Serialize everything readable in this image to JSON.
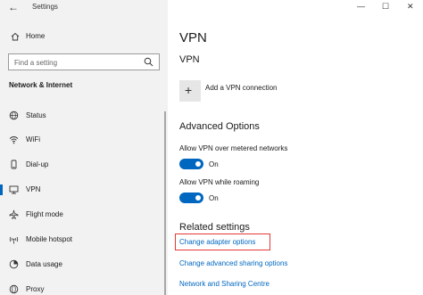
{
  "window": {
    "title": "Settings",
    "back_icon": "back-arrow-icon",
    "controls": {
      "minimize": "—",
      "maximize": "☐",
      "close": "✕"
    }
  },
  "sidebar": {
    "home_label": "Home",
    "search_placeholder": "Find a setting",
    "section_title": "Network & Internet",
    "items": [
      {
        "label": "Status",
        "icon": "status-globe-icon",
        "active": false
      },
      {
        "label": "WiFi",
        "icon": "wifi-icon",
        "active": false
      },
      {
        "label": "Dial-up",
        "icon": "dialup-phone-icon",
        "active": false
      },
      {
        "label": "VPN",
        "icon": "vpn-icon",
        "active": true
      },
      {
        "label": "Flight mode",
        "icon": "airplane-icon",
        "active": false
      },
      {
        "label": "Mobile hotspot",
        "icon": "hotspot-icon",
        "active": false
      },
      {
        "label": "Data usage",
        "icon": "data-usage-icon",
        "active": false
      },
      {
        "label": "Proxy",
        "icon": "proxy-globe-icon",
        "active": false
      }
    ]
  },
  "main": {
    "page_title": "VPN",
    "vpn_section_title": "VPN",
    "add_vpn_label": "Add a VPN connection",
    "advanced_title": "Advanced Options",
    "metered_label": "Allow VPN over metered networks",
    "metered_state": "On",
    "roaming_label": "Allow VPN while roaming",
    "roaming_state": "On",
    "related_title": "Related settings",
    "links": [
      "Change adapter options",
      "Change advanced sharing options",
      "Network and Sharing Centre"
    ]
  },
  "colors": {
    "accent": "#0067c0",
    "highlight_border": "#e53935",
    "sidebar_bg": "#f2f2f2"
  }
}
